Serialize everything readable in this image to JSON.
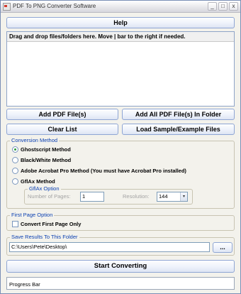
{
  "window": {
    "title": "PDF To PNG Converter Software",
    "min_label": "_",
    "max_label": "□",
    "close_label": "x"
  },
  "help_button": "Help",
  "dropzone": {
    "header": "Drag and drop files/folders here. Move | bar to the right if needed."
  },
  "buttons": {
    "add_pdf": "Add PDF File(s)",
    "add_all_pdf": "Add All PDF File(s) In Folder",
    "clear_list": "Clear List",
    "load_sample": "Load Sample/Example Files",
    "browse": "...",
    "start": "Start Converting"
  },
  "conversion": {
    "legend": "Conversion Method",
    "options": [
      {
        "label": "Ghostscript Method",
        "checked": true
      },
      {
        "label": "Black/White Method",
        "checked": false
      },
      {
        "label": "Adobe Acrobat Pro Method (You must have Acrobat Pro installed)",
        "checked": false
      },
      {
        "label": "GflAx Method",
        "checked": false
      }
    ],
    "gflax": {
      "legend": "GflAx Option",
      "pages_label": "Number of Pages:",
      "pages_value": "1",
      "resolution_label": "Resolution:",
      "resolution_value": "144"
    }
  },
  "first_page": {
    "legend": "First Page Option",
    "checkbox_label": "Convert First Page Only",
    "checked": false
  },
  "save": {
    "legend": "Save Results To This Folder",
    "path": "C:\\Users\\Pete\\Desktop\\"
  },
  "progress": {
    "label": "Progress Bar"
  }
}
